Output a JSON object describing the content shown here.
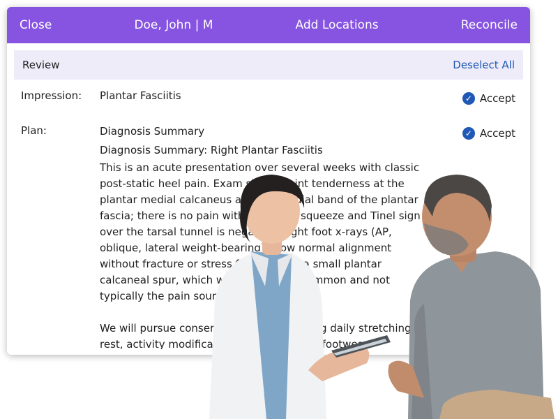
{
  "topbar": {
    "close_label": "Close",
    "patient_label": "Doe, John | M",
    "add_locations_label": "Add Locations",
    "reconcile_label": "Reconcile"
  },
  "review": {
    "title": "Review",
    "deselect_all_label": "Deselect All"
  },
  "impression": {
    "label": "Impression:",
    "value": "Plantar Fasciitis",
    "accept_label": "Accept"
  },
  "plan": {
    "label": "Plan:",
    "accept_label": "Accept",
    "title": "Diagnosis Summary",
    "subtitle": "Diagnosis Summary: Right Plantar Fasciitis",
    "lines": [
      "This is an acute presentation over several weeks with classic",
      "post-static heel pain. Exam shows point tenderness at the",
      "plantar medial calcaneus and the medial band of the plantar",
      "fascia; there is no pain with calcaneal squeeze and Tinel sign",
      "over the tarsal tunnel is negative. Right foot x-rays (AP,",
      "oblique, lateral weight-bearing) show normal alignment",
      "without fracture or stress fracture and a small plantar",
      "calcaneal spur, which we discussed is common and not",
      "typically the pain source.",
      "",
      "We will pursue conservative care, including daily stretching,",
      "rest, activity modification, and supportive footwear."
    ]
  },
  "colors": {
    "topbar": "#8654e0",
    "review_bar": "#efecf9",
    "link": "#1f58b5",
    "check": "#1f58b5"
  },
  "icons": {
    "accept": "check-circle-icon"
  }
}
